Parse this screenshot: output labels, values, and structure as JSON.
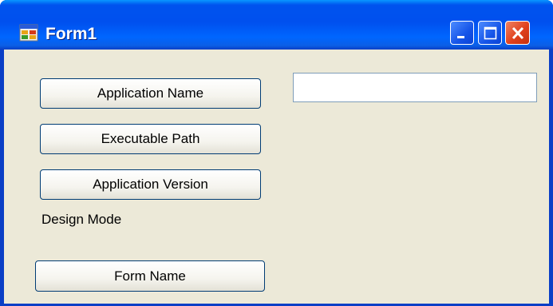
{
  "window": {
    "title": "Form1",
    "icon": "winforms-app-icon",
    "controls": {
      "minimize": "minimize-icon",
      "maximize": "maximize-icon",
      "close": "close-icon"
    }
  },
  "form": {
    "buttons": {
      "application_name": "Application Name",
      "executable_path": "Executable Path",
      "application_version": "Application Version",
      "form_name": "Form Name"
    },
    "label_design_mode": "Design Mode",
    "output_textbox": {
      "value": ""
    }
  },
  "colors": {
    "titlebar": "#0053ee",
    "client_bg": "#ece9d8",
    "close_button": "#e0401d",
    "button_border": "#003c74"
  }
}
